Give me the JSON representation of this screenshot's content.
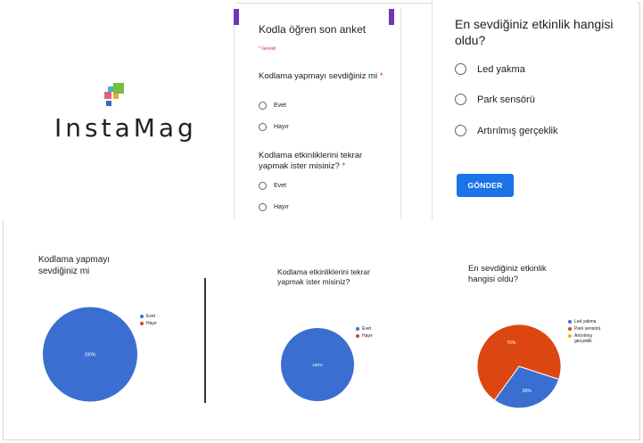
{
  "logo": {
    "text": "InstaMag",
    "colors": [
      "#e35d8a",
      "#7bbd3f",
      "#3fb7c9",
      "#f2a930",
      "#3a67c4"
    ]
  },
  "form": {
    "title": "Kodla öğren son anket",
    "required_note": "* Gerekli",
    "accent_color": "#673ab7",
    "q1": {
      "label": "Kodlama yapmayı sevdiğiniz mi",
      "required_star": "*",
      "options": [
        "Evet",
        "Hayır"
      ]
    },
    "q2": {
      "label": "Kodlama etkinliklerini tekrar yapmak ister misiniz?",
      "required_star": "*",
      "options": [
        "Evet",
        "Hayır"
      ]
    }
  },
  "big_question": {
    "title": "En sevdiğiniz etkinlik hangisi oldu?",
    "options": [
      "Led yakma",
      "Park sensörü",
      "Artırılmış gerçeklik"
    ],
    "submit_label": "GÖNDER",
    "submit_color": "#1a73e8"
  },
  "chart_data": [
    {
      "type": "pie",
      "title": "Kodlama yapmayı sevdiğiniz mi",
      "categories": [
        "Evet",
        "Hayır"
      ],
      "values": [
        100,
        0
      ],
      "slice_labels": [
        "100%"
      ],
      "colors": [
        "#3a6fd1",
        "#dc4611"
      ],
      "legend": "right"
    },
    {
      "type": "pie",
      "title": "Kodlama etkinliklerini tekrar yapmak ister misiniz?",
      "categories": [
        "Evet",
        "Hayır"
      ],
      "values": [
        100,
        0
      ],
      "slice_labels": [
        "100%"
      ],
      "colors": [
        "#3a6fd1",
        "#dc4611"
      ],
      "legend": "right"
    },
    {
      "type": "pie",
      "title": "En sevdiğiniz etkinlik hangisi oldu?",
      "categories": [
        "Led yakma",
        "Park sensörü",
        "Artırılmış gerçeklik"
      ],
      "values": [
        30,
        70,
        0
      ],
      "slice_labels": [
        "30%",
        "70%"
      ],
      "colors": [
        "#3a6fd1",
        "#dc4611",
        "#f4b400"
      ],
      "legend": "right"
    }
  ]
}
